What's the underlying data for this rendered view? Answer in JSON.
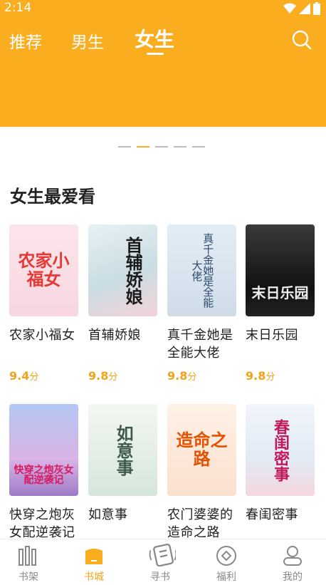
{
  "status": {
    "time": "2:14"
  },
  "tabs": [
    {
      "label": "推荐"
    },
    {
      "label": "男生"
    },
    {
      "label": "女生"
    }
  ],
  "section_title": "女生最爱看",
  "books": [
    {
      "title": "农家小福女",
      "rating": "9.4",
      "cover_text": "农家小福女"
    },
    {
      "title": "首辅娇娘",
      "rating": "9.8",
      "cover_text": "首辅娇娘"
    },
    {
      "title": "真千金她是全能大佬",
      "rating": "9.8",
      "cover_text": "真千金她是全能大佬"
    },
    {
      "title": "末日乐园",
      "rating": "9.8",
      "cover_text": "末日乐园"
    },
    {
      "title": "快穿之炮灰女配逆袭记",
      "cover_text": "快穿之炮灰女配逆袭记"
    },
    {
      "title": "如意事",
      "cover_text": "如意事"
    },
    {
      "title": "农门婆婆的造命之路",
      "cover_text": "造命之路"
    },
    {
      "title": "春闺密事",
      "cover_text": "春闺密事"
    }
  ],
  "rating_unit": "分",
  "bottom_nav": [
    {
      "label": "书架",
      "icon": "bookshelf-icon"
    },
    {
      "label": "书城",
      "icon": "bookstore-icon"
    },
    {
      "label": "寻书",
      "icon": "find-book-icon"
    },
    {
      "label": "福利",
      "icon": "welfare-icon"
    },
    {
      "label": "我的",
      "icon": "profile-icon"
    }
  ],
  "colors": {
    "accent": "#F9AD1F",
    "rating": "#F4A21B"
  }
}
